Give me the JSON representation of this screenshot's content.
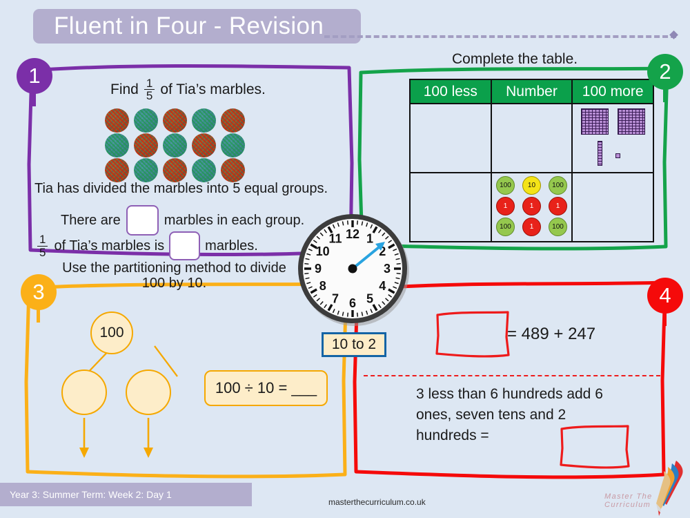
{
  "header": {
    "title": "Fluent in Four - Revision"
  },
  "colors": {
    "background": "#dde7f3",
    "title_bar": "#b3aece",
    "q1_accent": "#7b2fa8",
    "q2_accent": "#14a34a",
    "q3_accent": "#fbb018",
    "q4_accent": "#f50a0a",
    "table_header": "#0ba04b",
    "clock_label_border": "#1464a5",
    "counter_green": "#95c84e",
    "counter_yellow": "#f4e318",
    "counter_red": "#e8221a",
    "base10_block": "#b98fd6"
  },
  "questions": [
    {
      "number": "1",
      "prompt_prefix": "Find",
      "fraction": {
        "numerator": "1",
        "denominator": "5"
      },
      "prompt_suffix": "of Tia’s marbles.",
      "marbles_count": 15,
      "marbles_rows": 3,
      "marbles_cols": 5,
      "line2": "Tia has divided the marbles into 5 equal groups.",
      "line3_before": "There are",
      "line3_after": "marbles in each group.",
      "line3_answer": "",
      "line4_before": "of Tia’s marbles is",
      "line4_after": "marbles.",
      "line4_answer": ""
    },
    {
      "number": "2",
      "prompt": "Complete the table.",
      "table": {
        "headers": [
          "100 less",
          "Number",
          "100 more"
        ],
        "rows": [
          {
            "100_less": "",
            "number": "",
            "100_more": "base-ten-blocks"
          },
          {
            "100_less": "",
            "number": "place-value-counters",
            "100_more": ""
          }
        ]
      },
      "base_ten_blocks": {
        "hundreds": 2,
        "tens": 1,
        "ones": 1,
        "value": "211"
      },
      "place_value_counters": [
        {
          "label": "100",
          "color": "green"
        },
        {
          "label": "10",
          "color": "yellow"
        },
        {
          "label": "100",
          "color": "green"
        },
        {
          "label": "1",
          "color": "red"
        },
        {
          "label": "1",
          "color": "red"
        },
        {
          "label": "1",
          "color": "red"
        },
        {
          "label": "100",
          "color": "green"
        },
        {
          "label": "1",
          "color": "red"
        },
        {
          "label": "100",
          "color": "green"
        }
      ]
    },
    {
      "number": "3",
      "prompt": "Use the partitioning method to divide 100 by 10.",
      "part_whole": {
        "whole": "100",
        "part_left": "",
        "part_right": ""
      },
      "equation": "100 ÷ 10 = ___"
    },
    {
      "number": "4",
      "top_answer": "",
      "top_equation": "= 489 + 247",
      "bottom_text": "3 less than 6 hundreds add 6 ones, seven tens and 2 hundreds =",
      "bottom_answer": ""
    }
  ],
  "clock": {
    "label": "10 to 2",
    "numerals": [
      "1",
      "2",
      "3",
      "4",
      "5",
      "6",
      "7",
      "8",
      "9",
      "10",
      "11",
      "12"
    ],
    "hand_points_to": "between 1 and 2"
  },
  "footer": {
    "term_info": "Year 3: Summer Term: Week 2: Day 1",
    "url": "masterthecurriculum.co.uk",
    "logo_text": "Master The Curriculum"
  }
}
